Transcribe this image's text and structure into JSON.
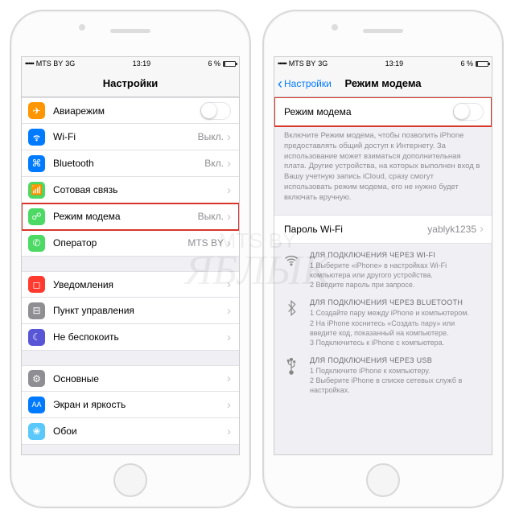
{
  "statusbar": {
    "carrier": "MTS BY",
    "network": "3G",
    "time": "13:19",
    "battery": "6 %",
    "signal_dots": "•••••"
  },
  "left": {
    "title": "Настройки",
    "rows": {
      "airplane": "Авиарежим",
      "wifi": "Wi-Fi",
      "wifi_val": "Выкл.",
      "bt": "Bluetooth",
      "bt_val": "Вкл.",
      "cellular": "Сотовая связь",
      "hotspot": "Режим модема",
      "hotspot_val": "Выкл.",
      "carrier": "Оператор",
      "carrier_val": "MTS BY",
      "notif": "Уведомления",
      "control": "Пункт управления",
      "dnd": "Не беспокоить",
      "general": "Основные",
      "display": "Экран и яркость",
      "wallpaper": "Обои"
    }
  },
  "right": {
    "back": "Настройки",
    "title": "Режим модема",
    "toggle_label": "Режим модема",
    "desc": "Включите Режим модема, чтобы позволить iPhone предоставлять общий доступ к Интернету. За использование может взиматься дополнительная плата. Другие устройства, на которых выполнен вход в Вашу учетную запись iCloud, сразу смогут использовать режим модема, его не нужно будет включать вручную.",
    "pwd_label": "Пароль Wi-Fi",
    "pwd_val": "yablyk1235",
    "wifi": {
      "title": "ДЛЯ ПОДКЛЮЧЕНИЯ ЧЕРЕЗ WI-FI",
      "l1": "1 Выберите «iPhone» в настройках Wi-Fi компьютера или другого устройства.",
      "l2": "2 Введите пароль при запросе."
    },
    "bt_info": {
      "title": "ДЛЯ ПОДКЛЮЧЕНИЯ ЧЕРЕЗ BLUETOOTH",
      "l1": "1 Создайте пару между iPhone и компьютером.",
      "l2": "2 На iPhone коснитесь «Создать пару» или введите код, показанный на компьютере.",
      "l3": "3 Подключитесь к iPhone с компьютера."
    },
    "usb": {
      "title": "ДЛЯ ПОДКЛЮЧЕНИЯ ЧЕРЕЗ USB",
      "l1": "1 Подключите iPhone к компьютеру.",
      "l2": "2 Выберите iPhone в списке сетевых служб в настройках."
    }
  },
  "wm": {
    "small": "MTS BY",
    "big": "ЯБЛЫК"
  }
}
